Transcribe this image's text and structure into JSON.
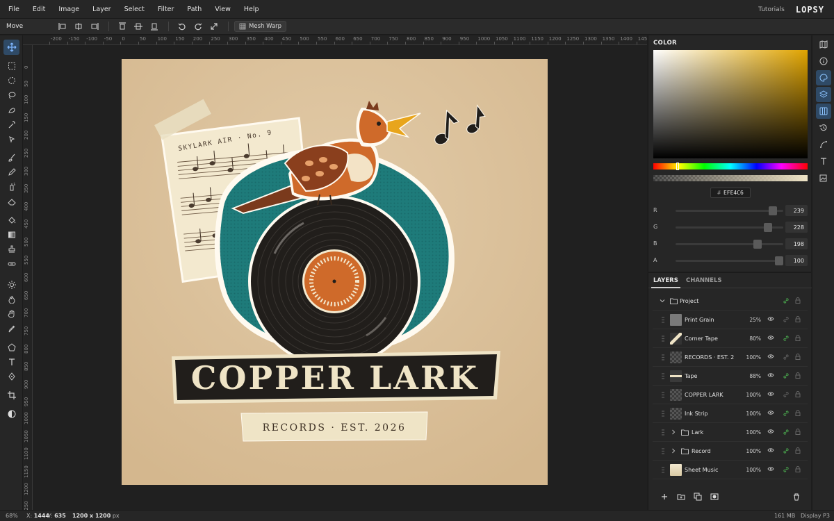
{
  "menu": {
    "items": [
      "File",
      "Edit",
      "Image",
      "Layer",
      "Select",
      "Filter",
      "Path",
      "View",
      "Help"
    ],
    "tutorials": "Tutorials",
    "logo": "LOPSY"
  },
  "options_bar": {
    "tool_name": "Move",
    "mesh_warp_label": "Mesh Warp"
  },
  "ruler": {
    "h_labels": [
      "-200",
      "-150",
      "-100",
      "-50",
      "0",
      "50",
      "100",
      "150",
      "200",
      "250",
      "300",
      "350",
      "400",
      "450",
      "500",
      "550",
      "600",
      "650",
      "700",
      "750",
      "800",
      "850",
      "900",
      "950",
      "1000",
      "1050",
      "1100",
      "1150",
      "1200",
      "1250",
      "1300",
      "1350",
      "1400",
      "1450"
    ],
    "v_labels": [
      "0",
      "50",
      "100",
      "150",
      "200",
      "250",
      "300",
      "350",
      "400",
      "450",
      "500",
      "550",
      "600",
      "650",
      "700",
      "750",
      "800",
      "850",
      "900",
      "950",
      "1000",
      "1050",
      "1100",
      "1150",
      "1200",
      "1250"
    ]
  },
  "artwork": {
    "sheet_title": "SKYLARK AIR · No. 9",
    "wordmark": "COPPER LARK",
    "tagline": "RECORDS · EST. 2026",
    "label_ring_text": "COPPER LARK · SIDE A · 33⅓",
    "colors": {
      "background": "#d9bf99",
      "teal": "#1e7b7a",
      "copper": "#cf6a2a",
      "ink": "#211e1b",
      "cream": "#efe4c6"
    }
  },
  "color_panel": {
    "title": "COLOR",
    "hex": "EFE4C6",
    "hex_prefix": "#",
    "channels": [
      {
        "label": "R",
        "value": "239"
      },
      {
        "label": "G",
        "value": "228"
      },
      {
        "label": "B",
        "value": "198"
      },
      {
        "label": "A",
        "value": "100"
      }
    ],
    "channel_levels": [
      0.94,
      0.89,
      0.78,
      1.0
    ]
  },
  "layers_panel": {
    "tabs": [
      "LAYERS",
      "CHANNELS"
    ],
    "group": "Project",
    "layers": [
      {
        "name": "Print Grain",
        "opacity": "25%"
      },
      {
        "name": "Corner Tape",
        "opacity": "80%"
      },
      {
        "name": "RECORDS · EST. 2",
        "opacity": "100%"
      },
      {
        "name": "Tape",
        "opacity": "88%"
      },
      {
        "name": "COPPER LARK",
        "opacity": "100%"
      },
      {
        "name": "Ink Strip",
        "opacity": "100%"
      },
      {
        "name": "Lark",
        "opacity": "100%"
      },
      {
        "name": "Record",
        "opacity": "100%"
      },
      {
        "name": "Sheet Music",
        "opacity": "100%"
      }
    ]
  },
  "status": {
    "zoom": "68%",
    "x_label": "X:",
    "x_value": "1444",
    "y_label": "Y:",
    "y_value": "635",
    "doc_size": "1200 x 1200",
    "doc_unit": "px",
    "memory": "161 MB",
    "display": "Display P3"
  }
}
